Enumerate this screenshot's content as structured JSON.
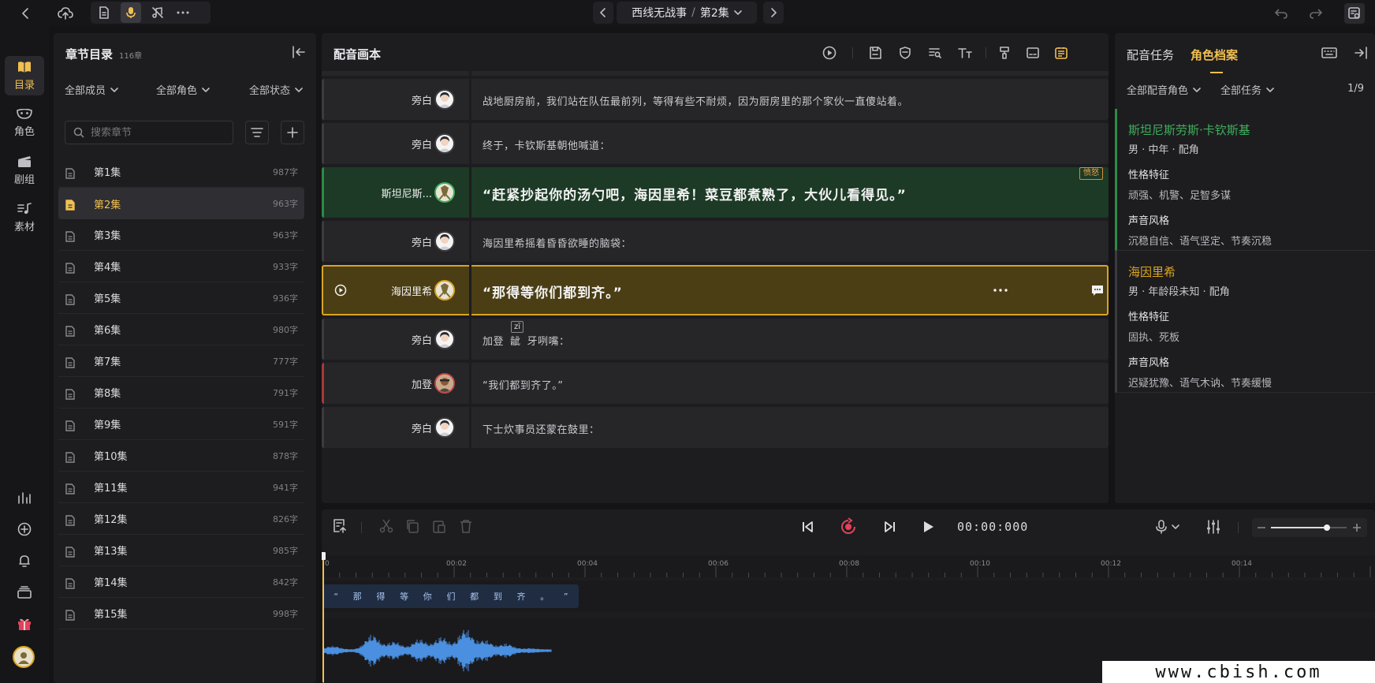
{
  "topbar": {
    "title": "西线无战事",
    "episode": "第2集",
    "separator": "/"
  },
  "rail": {
    "items": [
      {
        "label": "目录"
      },
      {
        "label": "角色"
      },
      {
        "label": "剧组"
      },
      {
        "label": "素材"
      }
    ]
  },
  "chapters": {
    "title": "章节目录",
    "count": "116章",
    "filters": [
      "全部成员",
      "全部角色",
      "全部状态"
    ],
    "search_placeholder": "搜索章节",
    "items": [
      {
        "name": "第1集",
        "words": "987字"
      },
      {
        "name": "第2集",
        "words": "963字"
      },
      {
        "name": "第3集",
        "words": "963字"
      },
      {
        "name": "第4集",
        "words": "933字"
      },
      {
        "name": "第5集",
        "words": "936字"
      },
      {
        "name": "第6集",
        "words": "980字"
      },
      {
        "name": "第7集",
        "words": "777字"
      },
      {
        "name": "第8集",
        "words": "791字"
      },
      {
        "name": "第9集",
        "words": "591字"
      },
      {
        "name": "第10集",
        "words": "878字"
      },
      {
        "name": "第11集",
        "words": "941字"
      },
      {
        "name": "第12集",
        "words": "826字"
      },
      {
        "name": "第13集",
        "words": "985字"
      },
      {
        "name": "第14集",
        "words": "842字"
      },
      {
        "name": "第15集",
        "words": "998字"
      }
    ]
  },
  "script": {
    "title": "配音画本",
    "rows": [
      {
        "role": "旁白",
        "text": "战地厨房前，我们站在队伍最前列，等得有些不耐烦，因为厨房里的那个家伙一直傻站着。"
      },
      {
        "role": "旁白",
        "text": "终于，卡钦斯基朝他喊道："
      },
      {
        "role": "斯坦尼斯...",
        "text": "“赶紧抄起你的汤勺吧，海因里希！菜豆都煮熟了，大伙儿看得见。”",
        "emotion": "愤怒"
      },
      {
        "role": "旁白",
        "text": "海因里希摇着昏昏欲睡的脑袋："
      },
      {
        "role": "海因里希",
        "text": "“那得等你们都到齐。”"
      },
      {
        "role": "旁白",
        "text_a": "加登",
        "text_b": "龇",
        "text_c": "牙咧嘴：",
        "pinyin": "zī"
      },
      {
        "role": "加登",
        "text": "“我们都到齐了。”"
      },
      {
        "role": "旁白",
        "text": "下士炊事员还蒙在鼓里："
      }
    ]
  },
  "profile": {
    "tabs": [
      "配音任务",
      "角色档案"
    ],
    "filters": [
      "全部配音角色",
      "全部任务"
    ],
    "page": "1/9",
    "roles": [
      {
        "name": "斯坦尼斯劳斯·卡钦斯基",
        "meta": "男 · 中年 · 配角",
        "trait_h": "性格特征",
        "trait": "顽强、机警、足智多谋",
        "voice_h": "声音风格",
        "voice": "沉稳自信、语气坚定、节奏沉稳",
        "color": "#3fae5c"
      },
      {
        "name": "海因里希",
        "meta": "男 · 年龄段未知 · 配角",
        "trait_h": "性格特征",
        "trait": "固执、死板",
        "voice_h": "声音风格",
        "voice": "迟疑犹豫、语气木讷、节奏缓慢",
        "color": "#d9a520"
      }
    ]
  },
  "timeline": {
    "time": "00:00:000",
    "ruler": [
      "0",
      "00:02",
      "00:04",
      "00:06",
      "00:08",
      "00:10",
      "00:12",
      "00:14"
    ],
    "clip_chars": [
      "“",
      "那",
      "得",
      "等",
      "你",
      "们",
      "都",
      "到",
      "齐",
      "。",
      "”"
    ]
  },
  "watermark": "www.cbish.com"
}
